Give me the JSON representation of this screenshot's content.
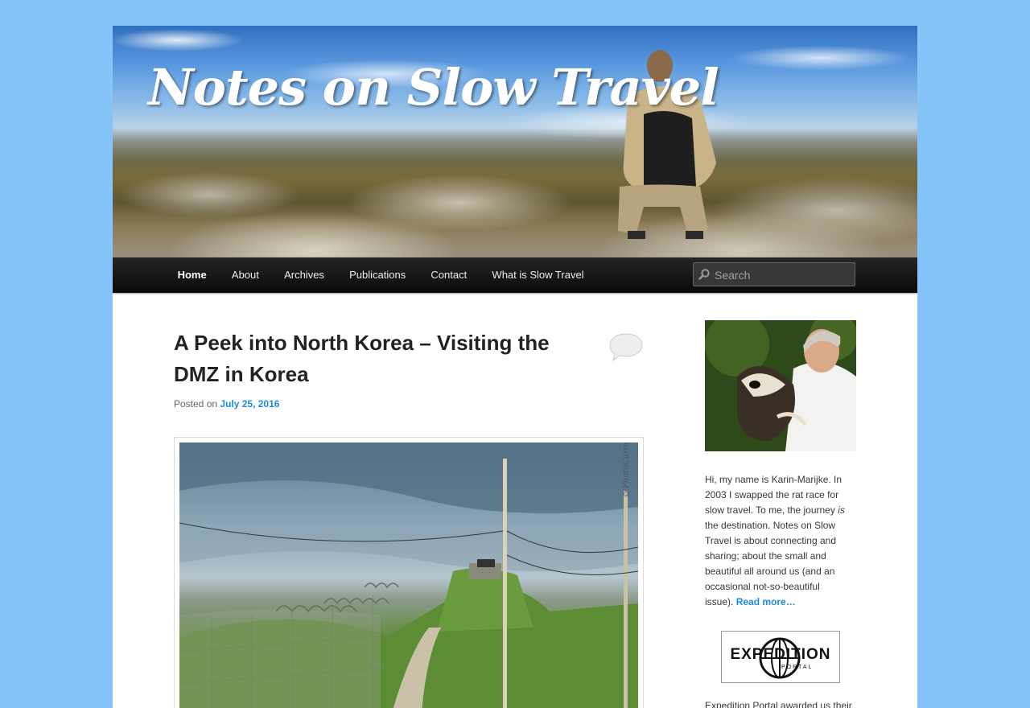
{
  "site": {
    "title": "Notes on Slow Travel"
  },
  "nav": {
    "items": [
      {
        "label": "Home",
        "current": true
      },
      {
        "label": "About"
      },
      {
        "label": "Archives"
      },
      {
        "label": "Publications"
      },
      {
        "label": "Contact"
      },
      {
        "label": "What is Slow Travel"
      }
    ],
    "search_placeholder": "Search"
  },
  "post": {
    "title": "A Peek into North Korea – Visiting the DMZ in Korea",
    "posted_on_label": "Posted on",
    "date": "July 25, 2016",
    "image_watermark": "©PhotoCarm"
  },
  "sidebar": {
    "bio_before": "Hi, my name is Karin-Marijke. In 2003 I swapped the rat race for slow travel. To me, the journey ",
    "bio_emphasis": "is",
    "bio_after": " the destination. Notes on Slow Travel is about connecting and sharing; about the small and beautiful all around us (and an occasional not-so-beautiful issue). ",
    "read_more": "Read more…",
    "badge_title": "EXPEDITION",
    "badge_subtitle": "PORTAL",
    "award_text": "Expedition Portal awarded us their"
  },
  "colors": {
    "background": "#85c4f8",
    "link": "#1b8be0",
    "nav_bg": "#111111"
  },
  "icons": [
    "search-icon",
    "comment-bubble-icon",
    "globe-icon"
  ]
}
